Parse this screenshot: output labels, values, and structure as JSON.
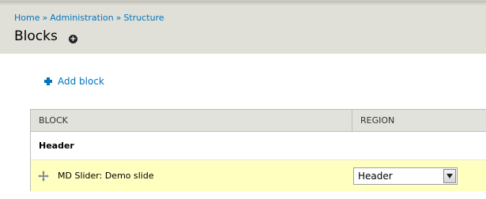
{
  "breadcrumb": {
    "home": "Home",
    "administration": "Administration",
    "structure": "Structure",
    "separator": "»"
  },
  "page": {
    "title": "Blocks",
    "shortcut_symbol": "+"
  },
  "actions": {
    "add_block": "Add block"
  },
  "table": {
    "headers": {
      "block": "BLOCK",
      "region": "REGION"
    },
    "region_group": "Header",
    "rows": [
      {
        "block": "MD Slider: Demo slide",
        "region": "Header"
      }
    ]
  },
  "colors": {
    "link": "#0074bd",
    "header_band": "#e0e0d8",
    "row_highlight": "#ffffbf"
  }
}
